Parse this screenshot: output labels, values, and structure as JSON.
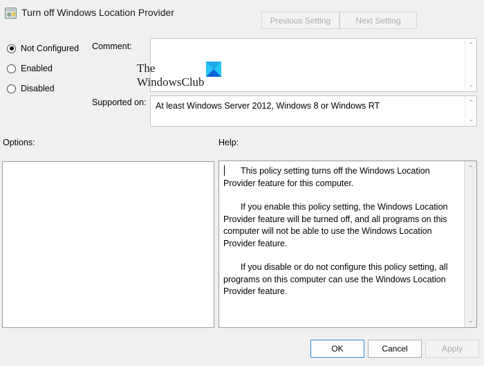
{
  "window": {
    "title": "Turn off Windows Location Provider",
    "icon": "policy-setting-icon",
    "background_color": "#f0f0f0"
  },
  "nav_buttons": {
    "previous_label": "Previous Setting",
    "next_label": "Next Setting",
    "previous_enabled": false,
    "next_enabled": false
  },
  "state_options": {
    "selected": "Not Configured",
    "items": [
      {
        "label": "Not Configured",
        "checked": true
      },
      {
        "label": "Enabled",
        "checked": false
      },
      {
        "label": "Disabled",
        "checked": false
      }
    ]
  },
  "comment": {
    "label": "Comment:",
    "value": "",
    "placeholder": ""
  },
  "supported_on": {
    "label": "Supported on:",
    "value": "At least Windows Server 2012, Windows 8 or Windows RT"
  },
  "options": {
    "label": "Options:",
    "value": ""
  },
  "help": {
    "label": "Help:",
    "paragraphs": [
      "This policy setting turns off the Windows Location Provider feature for this computer.",
      "If you enable this policy setting, the Windows Location Provider feature will be turned off, and all programs on this computer will not be able to use the Windows Location Provider feature.",
      "If you disable or do not configure this policy setting, all programs on this computer can use the Windows Location Provider feature."
    ]
  },
  "scrollbars": {
    "up_arrow": "⌃",
    "down_arrow": "⌄"
  },
  "action_buttons": {
    "ok_label": "OK",
    "cancel_label": "Cancel",
    "apply_label": "Apply",
    "ok_enabled": true,
    "cancel_enabled": true,
    "apply_enabled": false,
    "focus_accent_color": "#2a8adb"
  },
  "watermark": {
    "line1": "The",
    "line2": "WindowsClub",
    "logo_color_light": "#25c7f5",
    "logo_color_dark": "#0a63d8"
  }
}
